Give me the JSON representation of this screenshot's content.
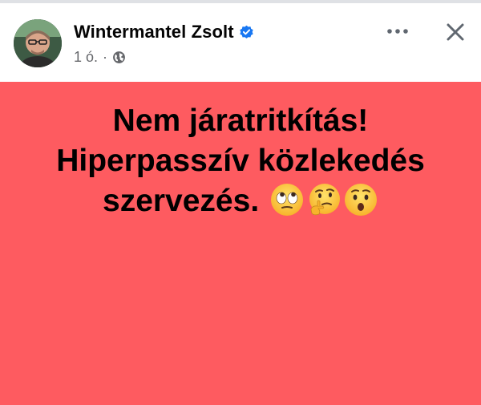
{
  "post": {
    "author": {
      "name": "Wintermantel Zsolt",
      "verified": true
    },
    "meta": {
      "time": "1 ó.",
      "separator": "·",
      "audience_icon": "globe-icon"
    },
    "actions": {
      "more_icon": "more-horizontal-icon",
      "close_icon": "close-icon"
    },
    "content": {
      "background_color": "#fe5b60",
      "lines": [
        "Nem járatritkítás!",
        "Hiperpasszív közlekedés",
        "szervezés."
      ],
      "emojis": [
        "face-with-rolling-eyes-emoji",
        "thinking-face-emoji",
        "hushed-face-emoji"
      ]
    }
  },
  "colors": {
    "name": "#050505",
    "meta": "#65676b",
    "verified_badge": "#1877f2",
    "post_background": "#fe5b60"
  }
}
